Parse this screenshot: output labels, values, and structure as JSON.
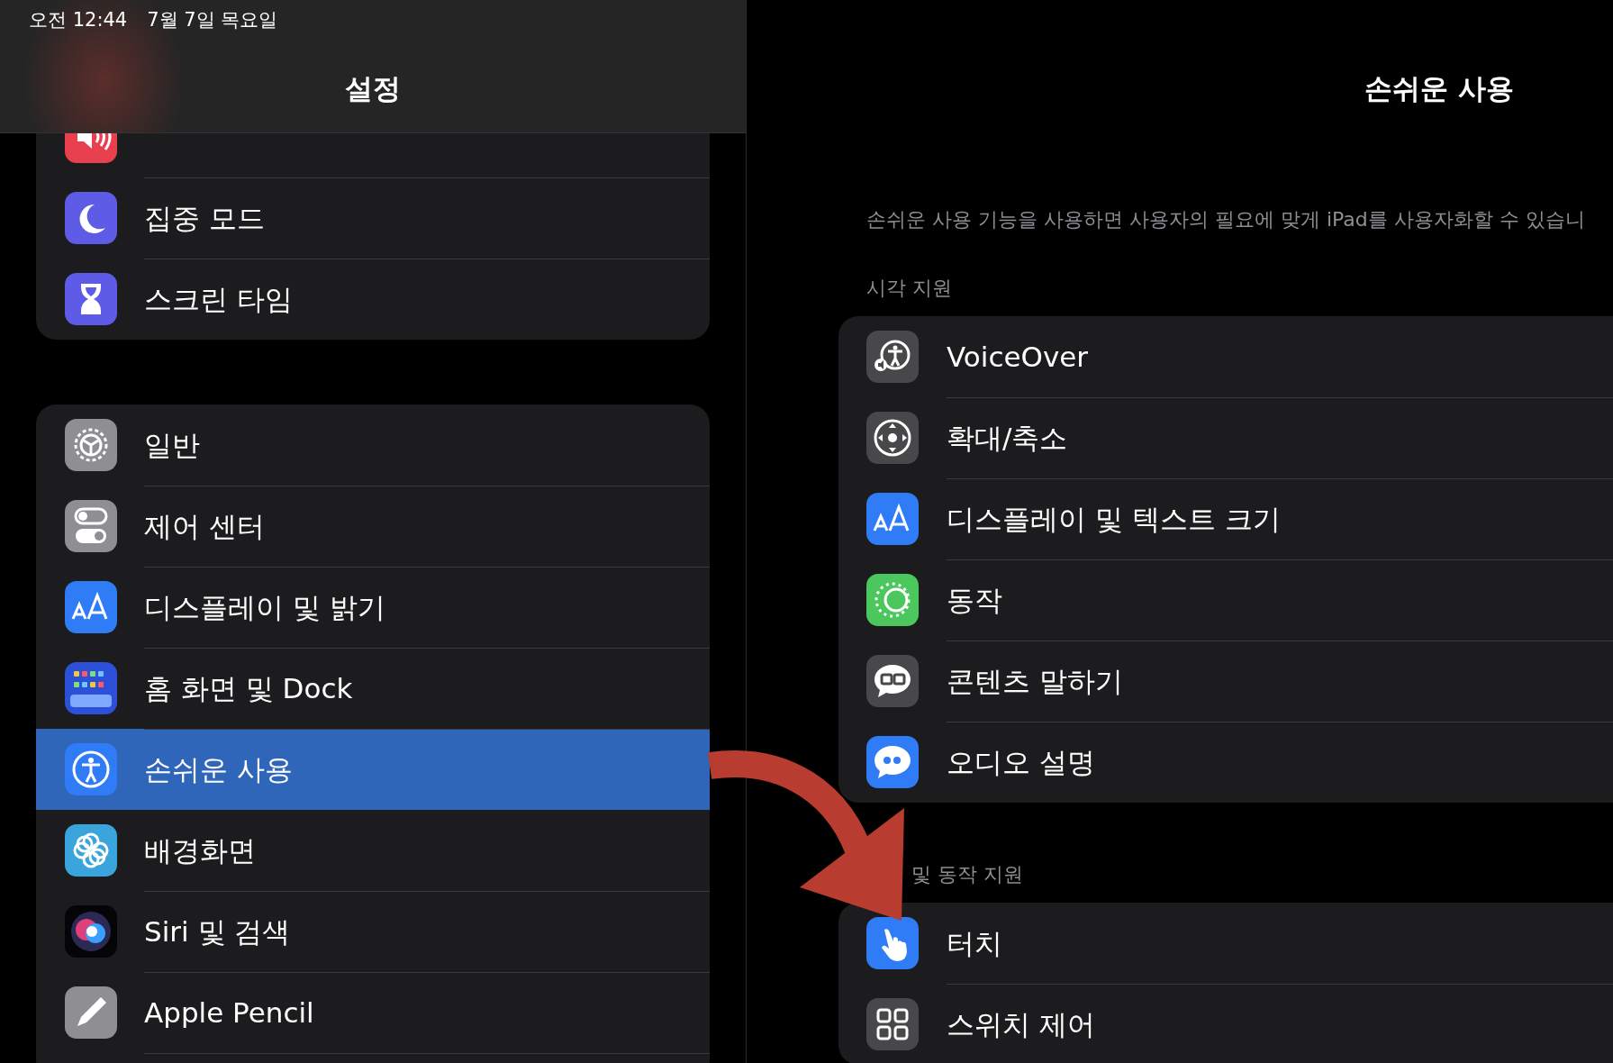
{
  "status_bar": {
    "time": "오전 12:44",
    "date": "7월 7일 목요일"
  },
  "sidebar": {
    "title": "설정",
    "groups": [
      [
        {
          "kind": "sound",
          "color": "#e8404f",
          "selected": false
        },
        {
          "label": "집중 모드",
          "kind": "moon",
          "color": "#5e5ce6",
          "selected": false
        },
        {
          "label": "스크린 타임",
          "kind": "hourglass",
          "color": "#5e5ce6",
          "selected": false
        }
      ],
      [
        {
          "label": "일반",
          "kind": "gear",
          "color": "#8e8e93",
          "selected": false
        },
        {
          "label": "제어 센터",
          "kind": "toggles",
          "color": "#8e8e93",
          "selected": false
        },
        {
          "label": "디스플레이 및 밝기",
          "kind": "textsize",
          "color": "#2f7cf6",
          "selected": false
        },
        {
          "label": "홈 화면 및 Dock",
          "kind": "appgrid",
          "color": "#2d50d8",
          "selected": false
        },
        {
          "label": "손쉬운 사용",
          "kind": "access",
          "color": "#2f7cf6",
          "selected": true
        },
        {
          "label": "배경화면",
          "kind": "flower",
          "color": "#3aa5dc",
          "selected": false
        },
        {
          "label": "Siri 및 검색",
          "kind": "siri",
          "color": "#050507",
          "selected": false
        },
        {
          "label": "Apple Pencil",
          "kind": "pencil",
          "color": "#8e8e93",
          "selected": false
        }
      ]
    ]
  },
  "detail": {
    "title": "손쉬운 사용",
    "description": "손쉬운 사용 기능을 사용하면 사용자의 필요에 맞게 iPad를 사용자화할 수 있습니",
    "sections": [
      {
        "header": "시각 지원",
        "items": [
          {
            "label": "VoiceOver",
            "kind": "voiceover",
            "color": "#48484a"
          },
          {
            "label": "확대/축소",
            "kind": "zoom",
            "color": "#48484a"
          },
          {
            "label": "디스플레이 및 텍스트 크기",
            "kind": "textsize",
            "color": "#2f7cf6"
          },
          {
            "label": "동작",
            "kind": "motion",
            "color": "#4cc75e"
          },
          {
            "label": "콘텐츠 말하기",
            "kind": "speech",
            "color": "#48484a"
          },
          {
            "label": "오디오 설명",
            "kind": "quote",
            "color": "#2f7cf6"
          }
        ]
      },
      {
        "header": "및 동작 지원",
        "items": [
          {
            "label": "터치",
            "kind": "hand",
            "color": "#2f7cf6"
          },
          {
            "label": "스위치 제어",
            "kind": "switchgrid",
            "color": "#48484a"
          }
        ]
      }
    ]
  }
}
